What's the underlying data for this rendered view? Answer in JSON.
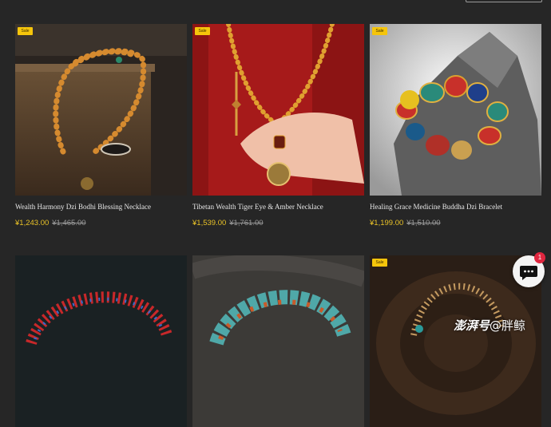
{
  "colors": {
    "background": "#262626",
    "sale_badge": "#f5c50b",
    "price": "#e9c227",
    "compare_price": "#9a9a9a",
    "chat_badge": "#e0263f"
  },
  "products": [
    {
      "badge": "Sale",
      "title": "Wealth Harmony Dzi Bodhi Blessing Necklace",
      "price": "¥1,243.00",
      "compare_price": "¥1,465.00"
    },
    {
      "badge": "Sale",
      "title": "Tibetan Wealth Tiger Eye & Amber Necklace",
      "price": "¥1,539.00",
      "compare_price": "¥1,761.00"
    },
    {
      "badge": "Sale",
      "title": "Healing Grace Medicine Buddha Dzi Bracelet",
      "price": "¥1,199.00",
      "compare_price": "¥1,510.00"
    },
    {
      "badge": ""
    },
    {
      "badge": ""
    },
    {
      "badge": "Sale"
    }
  ],
  "chat": {
    "icon": "chat-bubble-icon",
    "unread_count": "1"
  },
  "watermark": {
    "brand": "澎湃号",
    "handle": "@胖鲸"
  }
}
